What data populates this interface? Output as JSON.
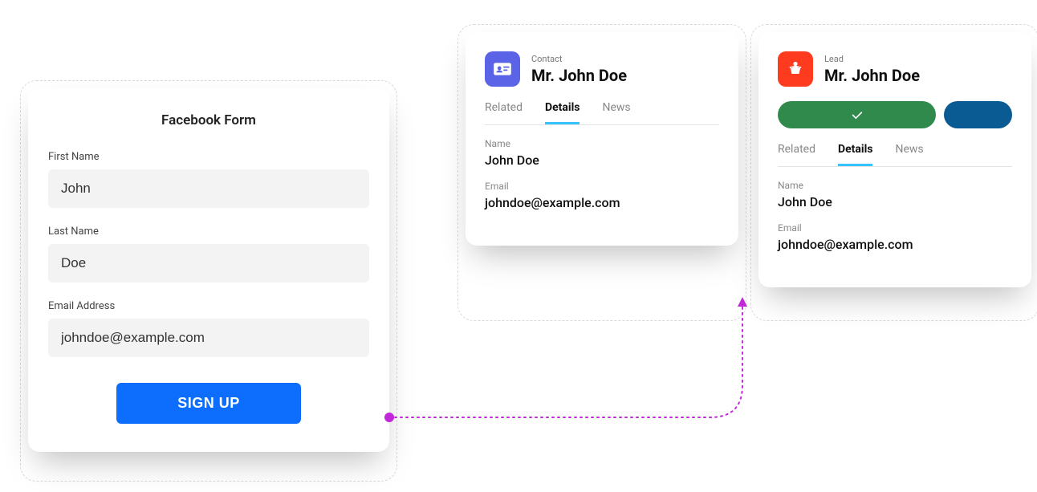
{
  "form": {
    "title": "Facebook Form",
    "first_name_label": "First Name",
    "first_name_value": "John",
    "last_name_label": "Last Name",
    "last_name_value": "Doe",
    "email_label": "Email Address",
    "email_value": "johndoe@example.com",
    "submit_label": "SIGN UP"
  },
  "contact": {
    "type_label": "Contact",
    "title_name": "Mr. John Doe",
    "tabs": {
      "related": "Related",
      "details": "Details",
      "news": "News"
    },
    "name_label": "Name",
    "name_value": "John Doe",
    "email_label": "Email",
    "email_value": "johndoe@example.com"
  },
  "lead": {
    "type_label": "Lead",
    "title_name": "Mr. John Doe",
    "tabs": {
      "related": "Related",
      "details": "Details",
      "news": "News"
    },
    "name_label": "Name",
    "name_value": "John Doe",
    "email_label": "Email",
    "email_value": "johndoe@example.com"
  },
  "colors": {
    "primary_blue": "#0d6efd",
    "contact_purple": "#5b63e6",
    "lead_orange": "#ff3b1f",
    "success_green": "#2f8a4c",
    "nav_blue": "#0a5a94",
    "tab_underline": "#36c3ff",
    "connector": "#c028d8"
  }
}
